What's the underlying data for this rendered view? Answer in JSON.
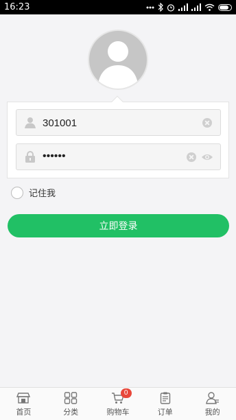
{
  "status_bar": {
    "time": "16:23"
  },
  "login_form": {
    "username": "301001",
    "password_mask": "••••••",
    "remember_label": "记住我",
    "submit_label": "立即登录"
  },
  "tab_bar": {
    "items": [
      {
        "label": "首页",
        "icon": "home-icon"
      },
      {
        "label": "分类",
        "icon": "category-grid-icon"
      },
      {
        "label": "购物车",
        "icon": "cart-icon",
        "badge": "0"
      },
      {
        "label": "订单",
        "icon": "order-clipboard-icon"
      },
      {
        "label": "我的",
        "icon": "profile-icon"
      }
    ]
  },
  "colors": {
    "accent": "#21c065",
    "badge": "#e8473a",
    "background": "#f4f4f6"
  }
}
